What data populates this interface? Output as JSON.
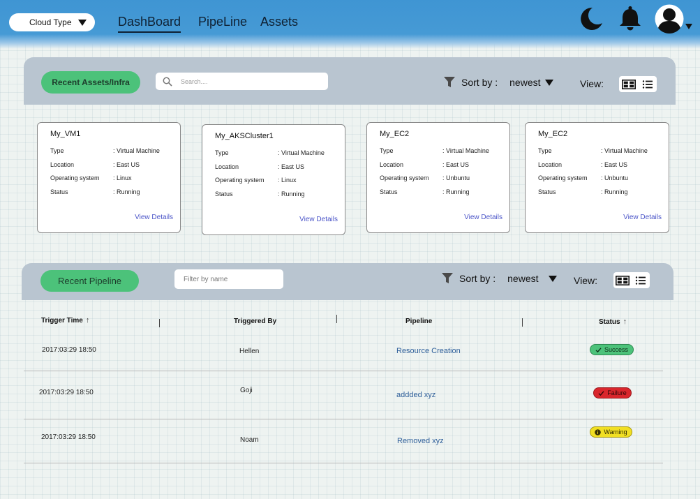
{
  "header": {
    "cloud_type_label": "Cloud Type",
    "nav": [
      {
        "label": "DashBoard",
        "active": true
      },
      {
        "label": "PipeLine",
        "active": false
      },
      {
        "label": "Assets",
        "active": false
      }
    ],
    "icons": [
      "moon-icon",
      "bell-icon",
      "user-avatar-icon",
      "chevron-down-icon"
    ],
    "colors": {
      "header_blue": "#469ad5",
      "accent_green": "#4cc27a",
      "panel_gray": "#b9c5d0"
    }
  },
  "assets_section": {
    "button_label": "Recent Assets/Infra",
    "search_placeholder": "Search....",
    "sort_label": "Sort by :",
    "sort_value": "newest",
    "view_label": "View:"
  },
  "cards": [
    {
      "title": "My_VM1",
      "fields": [
        {
          "key": "Type",
          "value": ": Virtual Machine"
        },
        {
          "key": "Location",
          "value": ": East US"
        },
        {
          "key": "Operating system",
          "value": ": Linux"
        },
        {
          "key": "Status",
          "value": ": Running"
        }
      ],
      "link": "View Details"
    },
    {
      "title": "My_AKSCluster1",
      "fields": [
        {
          "key": "Type",
          "value": ": Virtual Machine"
        },
        {
          "key": "Location",
          "value": ": East US"
        },
        {
          "key": "Operating system",
          "value": ": Linux"
        },
        {
          "key": "Status",
          "value": ": Running"
        }
      ],
      "link": "View Details"
    },
    {
      "title": "My_EC2",
      "fields": [
        {
          "key": "Type",
          "value": ": Virtual Machine"
        },
        {
          "key": "Location",
          "value": ": East US"
        },
        {
          "key": "Operating system",
          "value": ": Unbuntu"
        },
        {
          "key": "Status",
          "value": ": Running"
        }
      ],
      "link": "View Details"
    },
    {
      "title": "My_EC2",
      "fields": [
        {
          "key": "Type",
          "value": ": Virtual Machine"
        },
        {
          "key": "Location",
          "value": ": East US"
        },
        {
          "key": "Operating system",
          "value": ": Unbuntu"
        },
        {
          "key": "Status",
          "value": ": Running"
        }
      ],
      "link": "View Details"
    }
  ],
  "pipeline_section": {
    "button_label": "Recent Pipeline",
    "filter_placeholder": "Filter by name",
    "sort_label": "Sort by :",
    "sort_value": "newest",
    "view_label": "View:",
    "columns": [
      "Trigger Time",
      "Triggered By",
      "Pipeline",
      "Status"
    ],
    "sort_arrow": "↑",
    "rows": [
      {
        "time": "2017:03:29   18:50",
        "by": "Hellen",
        "pipeline": "Resource Creation",
        "status": "Success",
        "status_color": "#4cc27a"
      },
      {
        "time": "2017:03:29   18:50",
        "by": "Goji",
        "pipeline": "addded xyz",
        "status": "Failure",
        "status_color": "#d9262c"
      },
      {
        "time": "2017:03:29   18:50",
        "by": "Noam",
        "pipeline": "Removed xyz",
        "status": "Warning",
        "status_color": "#f1df22"
      }
    ]
  }
}
